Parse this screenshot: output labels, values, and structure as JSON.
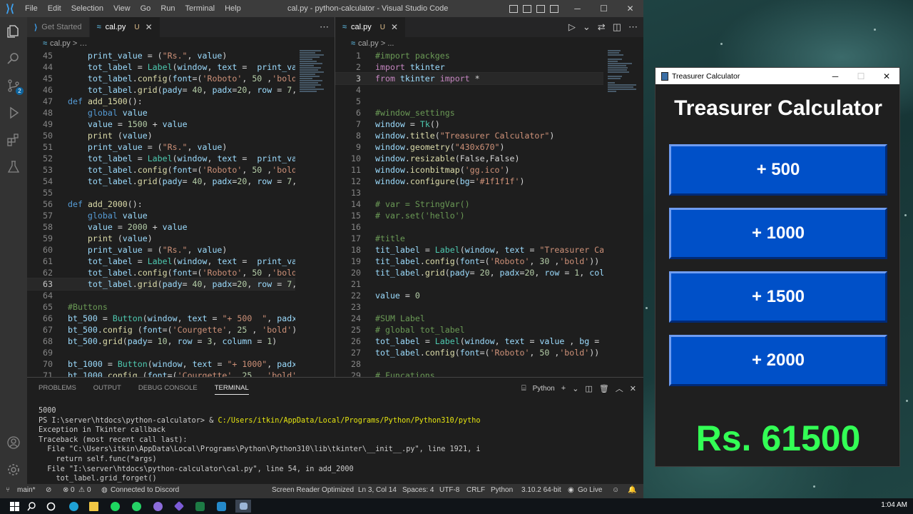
{
  "vscode": {
    "window_title": "cal.py - python-calculator - Visual Studio Code",
    "menu": [
      "File",
      "Edit",
      "Selection",
      "View",
      "Go",
      "Run",
      "Terminal",
      "Help"
    ],
    "left_tabs": [
      {
        "label": "Get Started"
      },
      {
        "label": "cal.py",
        "modified": "U"
      }
    ],
    "right_tabs": [
      {
        "label": "cal.py",
        "modified": "U"
      }
    ],
    "breadcrumb": "cal.py",
    "breadcrumb_right": "cal.py > ...",
    "scm_badge": "2",
    "left_lines": [
      {
        "n": "45",
        "t": "    print_value = (\"Rs.\", value)"
      },
      {
        "n": "44",
        "t": "    tot_label = Label(window, text =  print_val"
      },
      {
        "n": "45",
        "t": "    tot_label.config(font=('Roboto', 50 ,'bold'"
      },
      {
        "n": "46",
        "t": "    tot_label.grid(pady= 40, padx=20, row = 7,"
      },
      {
        "n": "47",
        "t": "def add_1500():"
      },
      {
        "n": "48",
        "t": "    global value"
      },
      {
        "n": "49",
        "t": "    value = 1500 + value"
      },
      {
        "n": "50",
        "t": "    print (value)"
      },
      {
        "n": "51",
        "t": "    print_value = (\"Rs.\", value)"
      },
      {
        "n": "52",
        "t": "    tot_label = Label(window, text =  print_val"
      },
      {
        "n": "53",
        "t": "    tot_label.config(font=('Roboto', 50 ,'bold'"
      },
      {
        "n": "54",
        "t": "    tot_label.grid(pady= 40, padx=20, row = 7,"
      },
      {
        "n": "55",
        "t": ""
      },
      {
        "n": "56",
        "t": "def add_2000():"
      },
      {
        "n": "57",
        "t": "    global value"
      },
      {
        "n": "58",
        "t": "    value = 2000 + value"
      },
      {
        "n": "59",
        "t": "    print (value)"
      },
      {
        "n": "60",
        "t": "    print_value = (\"Rs.\", value)"
      },
      {
        "n": "61",
        "t": "    tot_label = Label(window, text =  print_val"
      },
      {
        "n": "62",
        "t": "    tot_label.config(font=('Roboto', 50 ,'bold'"
      },
      {
        "n": "63",
        "t": "    tot_label.grid(pady= 40, padx=20, row = 7,"
      },
      {
        "n": "64",
        "t": ""
      },
      {
        "n": "65",
        "t": "#Buttons"
      },
      {
        "n": "66",
        "t": "bt_500 = Button(window, text = \"+ 500  \", padx"
      },
      {
        "n": "67",
        "t": "bt_500.config (font=('Courgette', 25 , 'bold'))"
      },
      {
        "n": "68",
        "t": "bt_500.grid(pady= 10, row = 3, column = 1)"
      },
      {
        "n": "69",
        "t": ""
      },
      {
        "n": "70",
        "t": "bt_1000 = Button(window, text = \"+ 1000\", padx"
      },
      {
        "n": "71",
        "t": "bt_1000.config (font=('Courgette', 25 , 'bold')"
      }
    ],
    "right_lines": [
      {
        "n": "1",
        "t": "#import packges"
      },
      {
        "n": "2",
        "t": "import tkinter"
      },
      {
        "n": "3",
        "t": "from tkinter import *"
      },
      {
        "n": "4",
        "t": ""
      },
      {
        "n": "5",
        "t": ""
      },
      {
        "n": "6",
        "t": "#window_settings"
      },
      {
        "n": "7",
        "t": "window = Tk()"
      },
      {
        "n": "8",
        "t": "window.title(\"Treasurer Calculator\")"
      },
      {
        "n": "9",
        "t": "window.geometry(\"430x670\")"
      },
      {
        "n": "10",
        "t": "window.resizable(False,False)"
      },
      {
        "n": "11",
        "t": "window.iconbitmap('gg.ico')"
      },
      {
        "n": "12",
        "t": "window.configure(bg='#1f1f1f')"
      },
      {
        "n": "13",
        "t": ""
      },
      {
        "n": "14",
        "t": "# var = StringVar()"
      },
      {
        "n": "15",
        "t": "# var.set('hello')"
      },
      {
        "n": "16",
        "t": ""
      },
      {
        "n": "17",
        "t": "#title"
      },
      {
        "n": "18",
        "t": "tit_label = Label(window, text = \"Treasurer Calc"
      },
      {
        "n": "19",
        "t": "tit_label.config(font=('Roboto', 30 ,'bold'))"
      },
      {
        "n": "20",
        "t": "tit_label.grid(pady= 20, padx=20, row = 1, colum"
      },
      {
        "n": "21",
        "t": ""
      },
      {
        "n": "22",
        "t": "value = 0"
      },
      {
        "n": "23",
        "t": ""
      },
      {
        "n": "24",
        "t": "#SUM Label"
      },
      {
        "n": "25",
        "t": "# global tot_label"
      },
      {
        "n": "26",
        "t": "tot_label = Label(window, text = value , bg = '"
      },
      {
        "n": "27",
        "t": "tot_label.config(font=('Roboto', 50 ,'bold'))"
      },
      {
        "n": "28",
        "t": ""
      },
      {
        "n": "29",
        "t": "# Funcations"
      }
    ],
    "panel": {
      "tabs": [
        "PROBLEMS",
        "OUTPUT",
        "DEBUG CONSOLE",
        "TERMINAL"
      ],
      "terminal_profile": "Python",
      "terminal_lines": [
        "5000",
        "PS I:\\server\\htdocs\\python-calculator> & C:/Users/itkin/AppData/Local/Programs/Python/Python310/pytho",
        "Exception in Tkinter callback",
        "Traceback (most recent call last):",
        "  File \"C:\\Users\\itkin\\AppData\\Local\\Programs\\Python\\Python310\\lib\\tkinter\\__init__.py\", line 1921, i",
        "    return self.func(*args)",
        "  File \"I:\\server\\htdocs\\python-calculator\\cal.py\", line 54, in add_2000",
        "    tot_label.grid_forget()"
      ]
    },
    "status": {
      "branch": "main*",
      "errors": "0",
      "warnings": "0",
      "discord": "Connected to Discord",
      "screen_reader": "Screen Reader Optimized",
      "position": "Ln 3, Col 14",
      "spaces": "Spaces: 4",
      "encoding": "UTF-8",
      "eol": "CRLF",
      "language": "Python",
      "interpreter": "3.10.2 64-bit",
      "golive": "Go Live"
    }
  },
  "tk": {
    "window_title": "Treasurer Calculator",
    "heading": "Treasurer Calculator",
    "buttons": [
      "+ 500",
      "+ 1000",
      "+ 1500",
      "+ 2000"
    ],
    "total": "Rs. 61500",
    "colors": {
      "background": "#1f1f1f",
      "button": "#0050c8",
      "total_text": "#33ff55"
    }
  },
  "taskbar": {
    "time": "1:04 AM",
    "apps": [
      "windows-start",
      "search",
      "task-view",
      "edge",
      "file-explorer",
      "spotify",
      "whatsapp",
      "github-desktop",
      "obsidian",
      "excel",
      "vscode",
      "tkinter-app"
    ]
  }
}
